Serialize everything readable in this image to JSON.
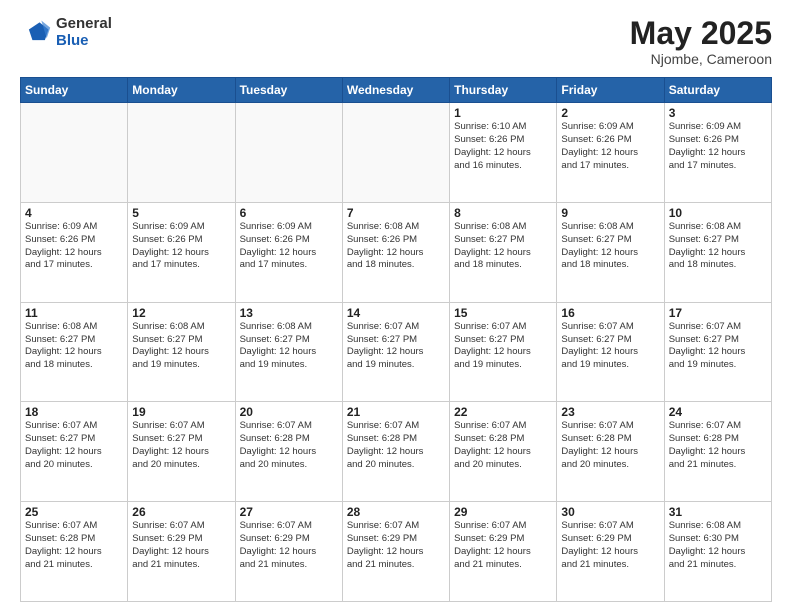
{
  "header": {
    "logo_general": "General",
    "logo_blue": "Blue",
    "month_title": "May 2025",
    "location": "Njombe, Cameroon"
  },
  "days_of_week": [
    "Sunday",
    "Monday",
    "Tuesday",
    "Wednesday",
    "Thursday",
    "Friday",
    "Saturday"
  ],
  "weeks": [
    [
      {
        "day": "",
        "info": ""
      },
      {
        "day": "",
        "info": ""
      },
      {
        "day": "",
        "info": ""
      },
      {
        "day": "",
        "info": ""
      },
      {
        "day": "1",
        "info": "Sunrise: 6:10 AM\nSunset: 6:26 PM\nDaylight: 12 hours\nand 16 minutes."
      },
      {
        "day": "2",
        "info": "Sunrise: 6:09 AM\nSunset: 6:26 PM\nDaylight: 12 hours\nand 17 minutes."
      },
      {
        "day": "3",
        "info": "Sunrise: 6:09 AM\nSunset: 6:26 PM\nDaylight: 12 hours\nand 17 minutes."
      }
    ],
    [
      {
        "day": "4",
        "info": "Sunrise: 6:09 AM\nSunset: 6:26 PM\nDaylight: 12 hours\nand 17 minutes."
      },
      {
        "day": "5",
        "info": "Sunrise: 6:09 AM\nSunset: 6:26 PM\nDaylight: 12 hours\nand 17 minutes."
      },
      {
        "day": "6",
        "info": "Sunrise: 6:09 AM\nSunset: 6:26 PM\nDaylight: 12 hours\nand 17 minutes."
      },
      {
        "day": "7",
        "info": "Sunrise: 6:08 AM\nSunset: 6:26 PM\nDaylight: 12 hours\nand 18 minutes."
      },
      {
        "day": "8",
        "info": "Sunrise: 6:08 AM\nSunset: 6:27 PM\nDaylight: 12 hours\nand 18 minutes."
      },
      {
        "day": "9",
        "info": "Sunrise: 6:08 AM\nSunset: 6:27 PM\nDaylight: 12 hours\nand 18 minutes."
      },
      {
        "day": "10",
        "info": "Sunrise: 6:08 AM\nSunset: 6:27 PM\nDaylight: 12 hours\nand 18 minutes."
      }
    ],
    [
      {
        "day": "11",
        "info": "Sunrise: 6:08 AM\nSunset: 6:27 PM\nDaylight: 12 hours\nand 18 minutes."
      },
      {
        "day": "12",
        "info": "Sunrise: 6:08 AM\nSunset: 6:27 PM\nDaylight: 12 hours\nand 19 minutes."
      },
      {
        "day": "13",
        "info": "Sunrise: 6:08 AM\nSunset: 6:27 PM\nDaylight: 12 hours\nand 19 minutes."
      },
      {
        "day": "14",
        "info": "Sunrise: 6:07 AM\nSunset: 6:27 PM\nDaylight: 12 hours\nand 19 minutes."
      },
      {
        "day": "15",
        "info": "Sunrise: 6:07 AM\nSunset: 6:27 PM\nDaylight: 12 hours\nand 19 minutes."
      },
      {
        "day": "16",
        "info": "Sunrise: 6:07 AM\nSunset: 6:27 PM\nDaylight: 12 hours\nand 19 minutes."
      },
      {
        "day": "17",
        "info": "Sunrise: 6:07 AM\nSunset: 6:27 PM\nDaylight: 12 hours\nand 19 minutes."
      }
    ],
    [
      {
        "day": "18",
        "info": "Sunrise: 6:07 AM\nSunset: 6:27 PM\nDaylight: 12 hours\nand 20 minutes."
      },
      {
        "day": "19",
        "info": "Sunrise: 6:07 AM\nSunset: 6:27 PM\nDaylight: 12 hours\nand 20 minutes."
      },
      {
        "day": "20",
        "info": "Sunrise: 6:07 AM\nSunset: 6:28 PM\nDaylight: 12 hours\nand 20 minutes."
      },
      {
        "day": "21",
        "info": "Sunrise: 6:07 AM\nSunset: 6:28 PM\nDaylight: 12 hours\nand 20 minutes."
      },
      {
        "day": "22",
        "info": "Sunrise: 6:07 AM\nSunset: 6:28 PM\nDaylight: 12 hours\nand 20 minutes."
      },
      {
        "day": "23",
        "info": "Sunrise: 6:07 AM\nSunset: 6:28 PM\nDaylight: 12 hours\nand 20 minutes."
      },
      {
        "day": "24",
        "info": "Sunrise: 6:07 AM\nSunset: 6:28 PM\nDaylight: 12 hours\nand 21 minutes."
      }
    ],
    [
      {
        "day": "25",
        "info": "Sunrise: 6:07 AM\nSunset: 6:28 PM\nDaylight: 12 hours\nand 21 minutes."
      },
      {
        "day": "26",
        "info": "Sunrise: 6:07 AM\nSunset: 6:29 PM\nDaylight: 12 hours\nand 21 minutes."
      },
      {
        "day": "27",
        "info": "Sunrise: 6:07 AM\nSunset: 6:29 PM\nDaylight: 12 hours\nand 21 minutes."
      },
      {
        "day": "28",
        "info": "Sunrise: 6:07 AM\nSunset: 6:29 PM\nDaylight: 12 hours\nand 21 minutes."
      },
      {
        "day": "29",
        "info": "Sunrise: 6:07 AM\nSunset: 6:29 PM\nDaylight: 12 hours\nand 21 minutes."
      },
      {
        "day": "30",
        "info": "Sunrise: 6:07 AM\nSunset: 6:29 PM\nDaylight: 12 hours\nand 21 minutes."
      },
      {
        "day": "31",
        "info": "Sunrise: 6:08 AM\nSunset: 6:30 PM\nDaylight: 12 hours\nand 21 minutes."
      }
    ]
  ]
}
